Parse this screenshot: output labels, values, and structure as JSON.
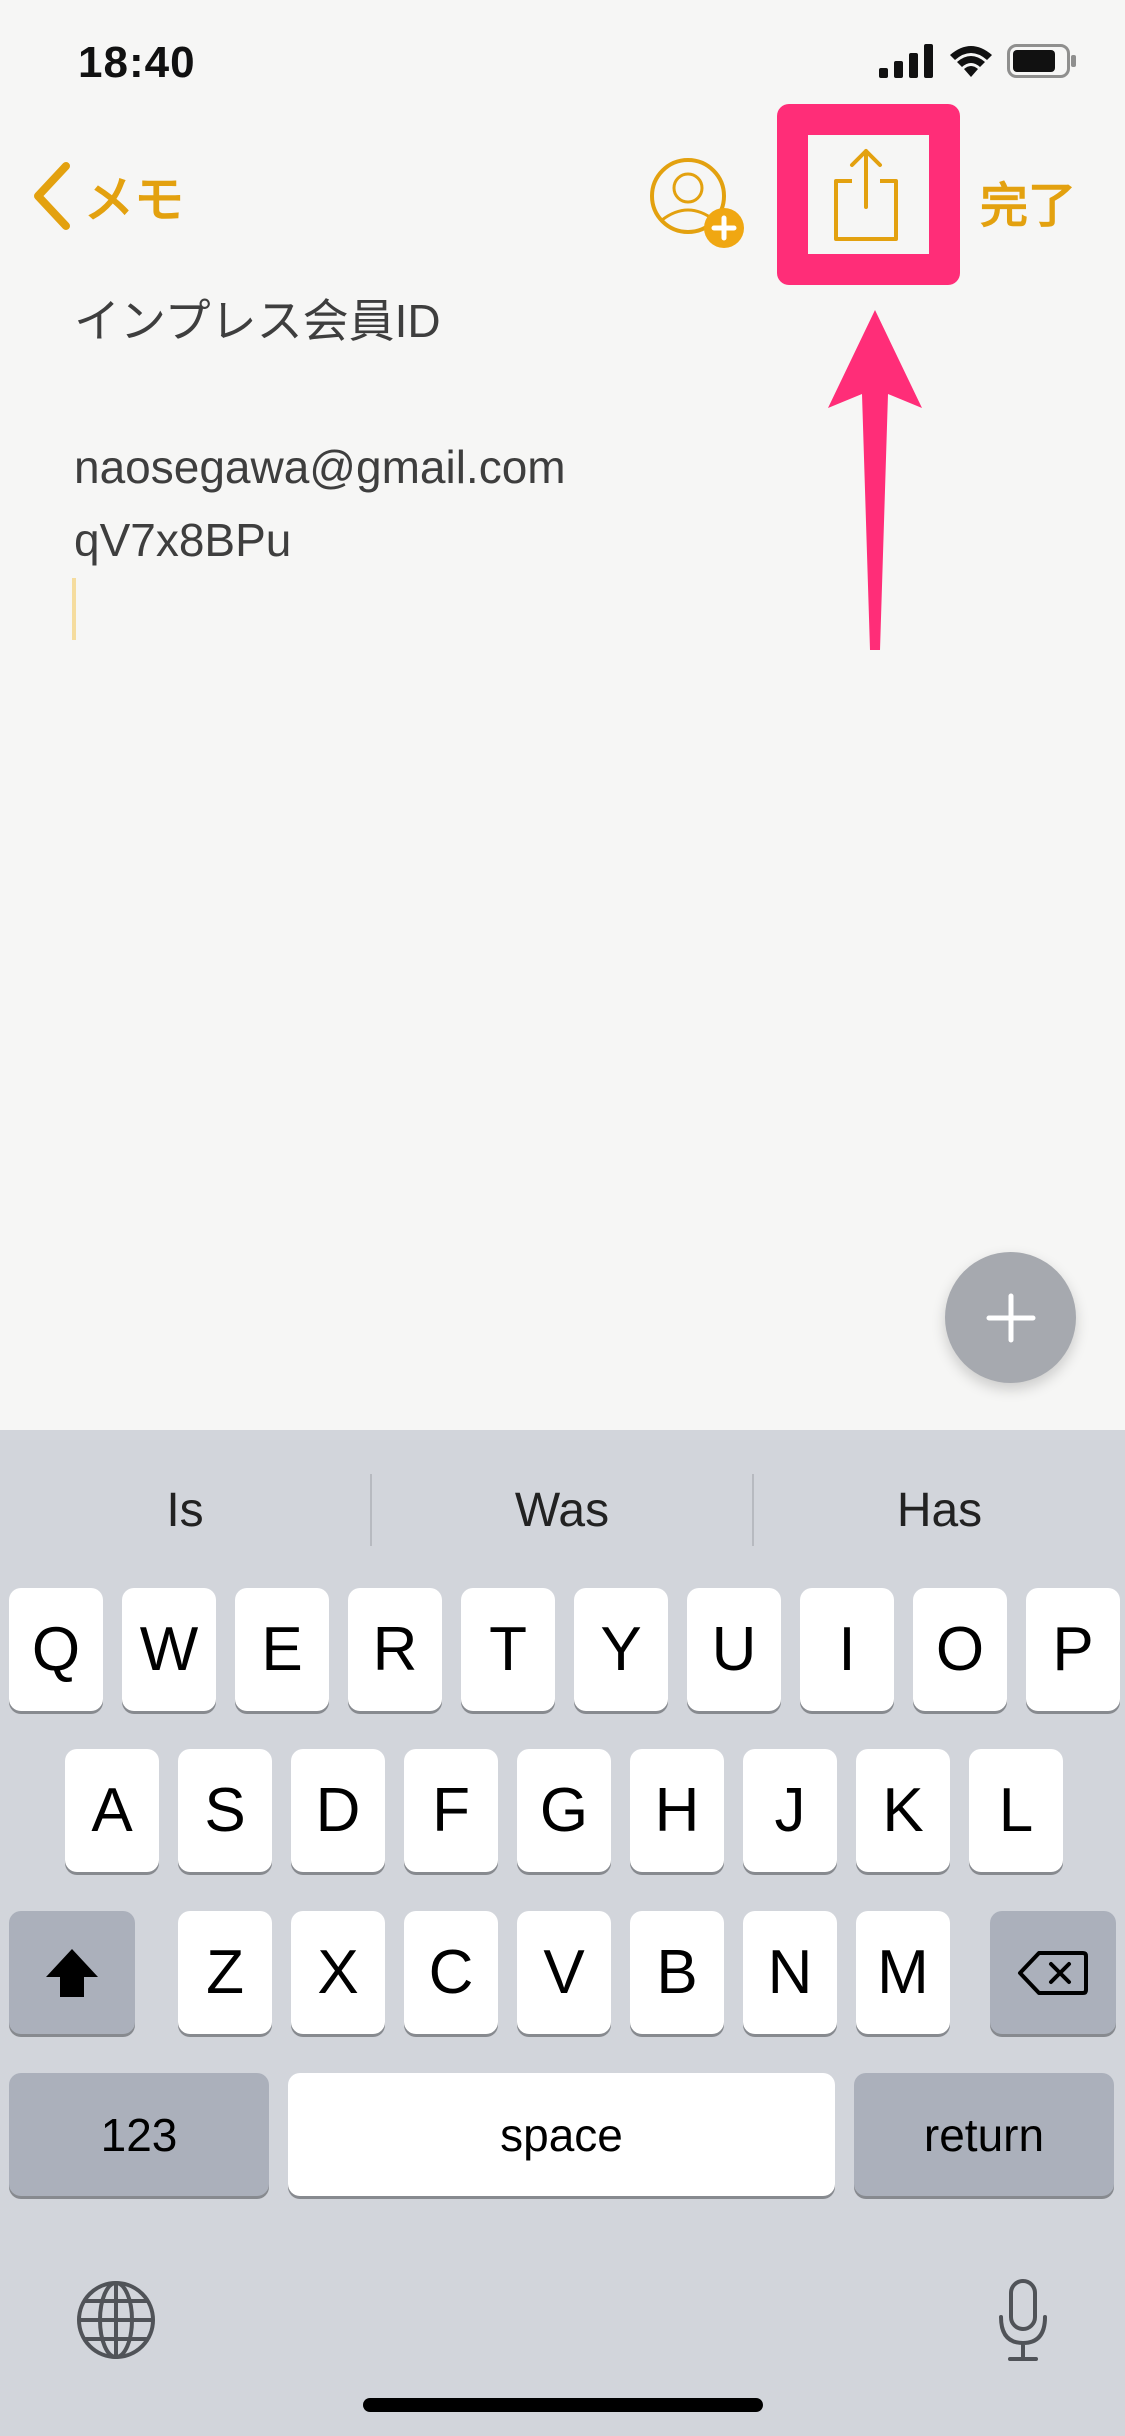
{
  "status_bar": {
    "time": "18:40"
  },
  "nav": {
    "back_label": "メモ",
    "done_label": "完了",
    "icons": [
      "chevron-left-icon",
      "add-person-icon",
      "share-icon"
    ]
  },
  "note": {
    "lines": [
      "インプレス会員ID",
      "",
      "naosegawa@gmail.com",
      "qV7x8BPu"
    ]
  },
  "annotation": {
    "highlight_color": "#ff2d78"
  },
  "keyboard": {
    "suggestions": [
      "Is",
      "Was",
      "Has"
    ],
    "row1": [
      "Q",
      "W",
      "E",
      "R",
      "T",
      "Y",
      "U",
      "I",
      "O",
      "P"
    ],
    "row2": [
      "A",
      "S",
      "D",
      "F",
      "G",
      "H",
      "J",
      "K",
      "L"
    ],
    "row3": [
      "Z",
      "X",
      "C",
      "V",
      "B",
      "N",
      "M"
    ],
    "numbers_label": "123",
    "space_label": "space",
    "return_label": "return"
  },
  "colors": {
    "accent": "#e3a10f",
    "keyboard_bg": "#d2d5db"
  }
}
